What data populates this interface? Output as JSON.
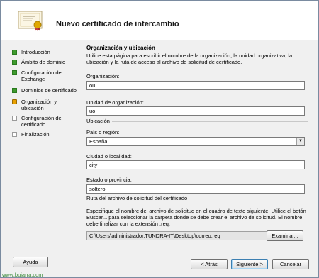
{
  "window": {
    "title": "Nuevo certificado de intercambio"
  },
  "steps": [
    {
      "label": "Introducción",
      "state": "done"
    },
    {
      "label": "Ámbito de dominio",
      "state": "done"
    },
    {
      "label": "Configuración de Exchange",
      "state": "done"
    },
    {
      "label": "Dominios de certificado",
      "state": "done"
    },
    {
      "label": "Organización y ubicación",
      "state": "current"
    },
    {
      "label": "Configuración del certificado",
      "state": "pending"
    },
    {
      "label": "Finalización",
      "state": "pending"
    }
  ],
  "page": {
    "section_title": "Organización y ubicación",
    "intro": "Utilice esta página para escribir el nombre de la organización, la unidad organizativa, la ubicación y la ruta de acceso al archivo de solicitud de certificado.",
    "organization_label": "Organización:",
    "organization_value": "ou",
    "org_unit_label": "Unidad de organización:",
    "org_unit_value": "uo",
    "location_group": "Ubicación",
    "country_label": "País o región:",
    "country_value": "España",
    "city_label": "Ciudad o localidad:",
    "city_value": "city",
    "state_label": "Estado o provincia:",
    "state_value": "soltero",
    "path_group": "Ruta del archivo de solicitud del certificado",
    "path_help": "Especifique el nombre del archivo de solicitud en el cuadro de texto siguiente. Utilice el botón Buscar... para seleccionar la carpeta donde se debe crear el archivo de solicitud. El nombre debe finalizar con la extensión .req.",
    "path_value": "C:\\Users\\administrador.TUNDRA-IT\\Desktop\\correo.req",
    "browse_label": "Examinar..."
  },
  "footer": {
    "help_label": "Ayuda",
    "back_label": "< Atrás",
    "next_label": "Siguiente >",
    "cancel_label": "Cancelar"
  },
  "watermark": "www.bujarra.com",
  "colors": {
    "done": "#3e9a2e",
    "current": "#e8a000",
    "watermark": "#3a8a3a"
  }
}
